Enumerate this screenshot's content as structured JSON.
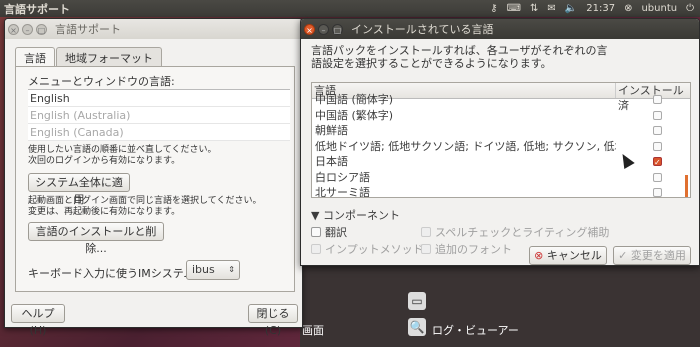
{
  "panel": {
    "title": "言語サポート",
    "time": "21:37",
    "user": "ubuntu"
  },
  "win1": {
    "title": "言語サポート",
    "tabs": [
      "言語",
      "地域フォーマット"
    ],
    "menu_lang_label": "メニューとウィンドウの言語:",
    "languages": [
      "English",
      "English (Australia)",
      "English (Canada)"
    ],
    "help_text1": "使用したい言語の順番に並べ直してください。",
    "help_text2": "次回のログインから有効になります。",
    "apply_system_button": "システム全体に適用",
    "help_text3": "起動画面とログイン画面で同じ言語を選択してください。",
    "help_text4": "変更は、再起動後に有効になります。",
    "install_remove_button": "言語のインストールと削除...",
    "im_label": "キーボード入力に使うIMシステム:",
    "im_value": "ibus",
    "help_button": "ヘルプ(H)",
    "close_button": "閉じる(C)"
  },
  "win2": {
    "title": "インストールされている言語",
    "desc1": "言語パックをインストールすれば、各ユーザがそれぞれの言",
    "desc2": "語設定を選択することができるようになります。",
    "col_lang": "言語",
    "col_installed": "インストール済",
    "rows": [
      {
        "name": "中国語 (簡体字)",
        "checked": false
      },
      {
        "name": "中国語 (繁体字)",
        "checked": false
      },
      {
        "name": "朝鮮語",
        "checked": false
      },
      {
        "name": "低地ドイツ語; 低地サクソン語; ドイツ語, 低地; サクソン, 低地",
        "checked": false
      },
      {
        "name": "日本語",
        "checked": true
      },
      {
        "name": "白ロシア語",
        "checked": false
      },
      {
        "name": "北サーミ語",
        "checked": false
      }
    ],
    "components_label": "コンポーネント",
    "translation": "翻訳",
    "input_method": "インプットメソッド",
    "spellcheck": "スペルチェックとライティング補助",
    "extra_fonts": "追加のフォント",
    "cancel_button": "キャンセル",
    "apply_button": "変更を適用"
  },
  "desktop": {
    "label_a": "画面",
    "label_b": "ログ・ビューアー"
  }
}
